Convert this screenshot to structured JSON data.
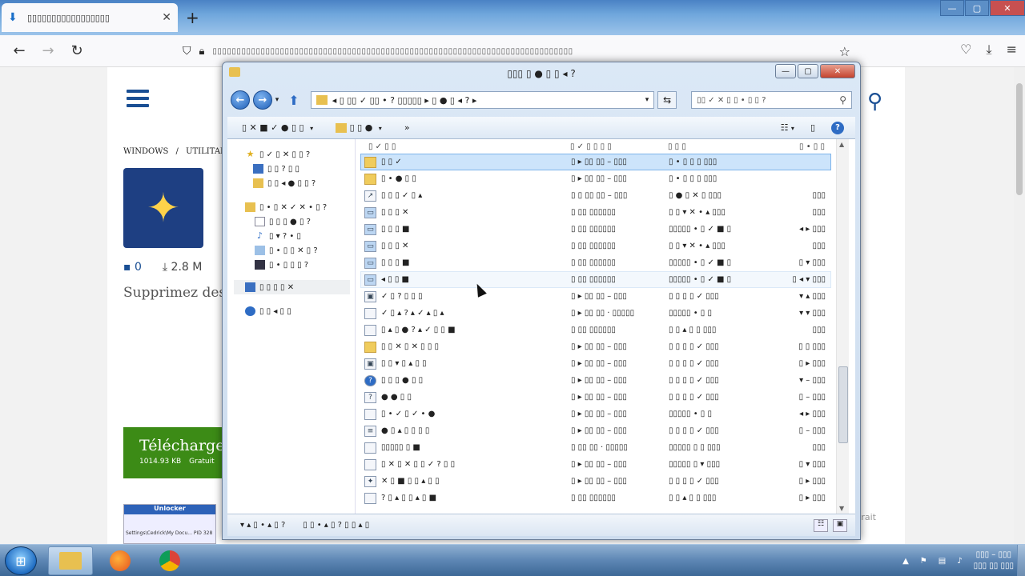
{
  "browser": {
    "tab_title": "▯▯▯▯▯▯▯▯▯▯▯▯▯▯▯▯▯",
    "tab_icon": "download-icon",
    "url": "▯▯▯▯▯▯▯▯▯▯▯▯▯▯▯▯▯▯▯▯▯▯▯▯▯▯▯▯▯▯▯▯▯▯▯▯▯▯▯▯▯▯▯▯▯▯▯▯▯▯▯▯▯▯▯▯▯▯▯▯▯▯▯▯▯▯▯▯▯▯▯▯▯▯▯"
  },
  "page": {
    "breadcrumb_windows": "WINDOWS",
    "breadcrumb_sep": "/",
    "breadcrumb_utilities": "UTILITAIR",
    "comments_count": "0",
    "downloads_count": "2.8 M",
    "description": "Supprimez des",
    "download_label": "Télécharge",
    "download_size": "1014.93 KB",
    "download_price": "Gratuit",
    "thumb_title": "Unlocker",
    "thumb_path": "Settings\\Cedrick\\My Docu...",
    "thumb_pid_label": "PID",
    "thumb_pid": "328",
    "side_word": "trait"
  },
  "explorer": {
    "title": "▯▯▯ ▯ ● ▯ ▯ ◂ ?",
    "address_path": "◂ ▯ ▯▯ ✓ ▯▯ • ? ▯▯▯▯▯ ▸ ▯ ● ▯ ◂ ? ▸",
    "search_placeholder": "▯▯ ✓ ✕ ▯ ▯ • ▯ ▯ ?",
    "toolbar_organize": "▯ ✕ ■ ✓ ● ▯ ▯",
    "toolbar_include": "▯ ▯ ●",
    "toolbar_more": "»",
    "nav": [
      {
        "label": "▯ ✓ ▯ ✕ ▯ ▯ ?",
        "icon": "star-icon"
      },
      {
        "label": "▯ ▯ ? ▯ ▯",
        "icon": "desktop-icon"
      },
      {
        "label": "▯ ▯ ◂ ● ▯ ▯ ?",
        "icon": "downloads-folder-icon"
      },
      {
        "label": "▯ • ▯ ✕ ✓ ✕ • ▯ ?",
        "icon": "libraries-icon"
      },
      {
        "label": "▯ ▯ ▯ ● ▯ ?",
        "icon": "documents-icon"
      },
      {
        "label": "▯ ▾ ? • ▯",
        "icon": "music-icon"
      },
      {
        "label": "▯ • ▯ ▯ ✕ ▯ ?",
        "icon": "pictures-icon"
      },
      {
        "label": "▯ • ▯ ▯ ▯ ?",
        "icon": "videos-icon"
      },
      {
        "label": "▯ ▯ ▯ ▯ ✕",
        "icon": "computer-icon"
      },
      {
        "label": "▯ ▯ ◂ ▯ ▯",
        "icon": "network-icon"
      }
    ],
    "columns": {
      "name": "▯ ✓ ▯ ▯",
      "date": "▯ ✓ ▯ ▯ ▯ ▯",
      "type": "▯ ▯ ▯",
      "size": "▯ • ▯ ▯"
    },
    "rows": [
      {
        "name": "▯ ▯ ✓",
        "date": "▯ ▸ ▯▯ ▯▯ – ▯▯▯",
        "type": "▯ • ▯ ▯ ▯ ▯▯▯",
        "size": "",
        "icon": "folder-icon"
      },
      {
        "name": "▯ • ● ▯ ▯",
        "date": "▯ ▸ ▯▯ ▯▯ – ▯▯▯",
        "type": "▯ • ▯ ▯ ▯ ▯▯▯",
        "size": "",
        "icon": "folder-icon"
      },
      {
        "name": "▯ ▯ ▯ ✓ ▯ ▴",
        "date": "▯ ▯ ▯▯ ▯▯ – ▯▯▯",
        "type": "▯ ● ▯ ✕ ▯ ▯▯▯",
        "size": "▯▯▯",
        "icon": "shortcut-icon"
      },
      {
        "name": "▯ ▯ ▯ ✕",
        "date": "▯ ▯▯ ▯▯▯▯▯▯",
        "type": "▯ ▯ ▾ ✕ • ▴ ▯▯▯",
        "size": "▯▯▯",
        "icon": "image-icon"
      },
      {
        "name": "▯ ▯ ▯ ■",
        "date": "▯ ▯▯ ▯▯▯▯▯▯",
        "type": "▯▯▯▯▯ • ▯ ✓ ■ ▯",
        "size": "◂ ▸ ▯▯▯",
        "icon": "image-icon"
      },
      {
        "name": "▯ ▯ ▯ ✕",
        "date": "▯ ▯▯ ▯▯▯▯▯▯",
        "type": "▯ ▯ ▾ ✕ • ▴ ▯▯▯",
        "size": "▯▯▯",
        "icon": "image-icon"
      },
      {
        "name": "▯ ▯ ▯ ■",
        "date": "▯ ▯▯ ▯▯▯▯▯▯",
        "type": "▯▯▯▯▯ • ▯ ✓ ■ ▯",
        "size": "▯ ▾ ▯▯▯",
        "icon": "image-icon"
      },
      {
        "name": "◂ ▯ ▯ ■",
        "date": "▯ ▯▯ ▯▯▯▯▯▯",
        "type": "▯▯▯▯▯ • ▯ ✓ ■ ▯",
        "size": "▯ ◂ ▾ ▯▯▯",
        "icon": "image-icon"
      },
      {
        "name": "✓ ▯ ? ▯ ▯ ▯",
        "date": "▯ ▸ ▯▯ ▯▯ – ▯▯▯",
        "type": "▯ ▯ ▯ ▯ ✓ ▯▯▯",
        "size": "▾ ▴ ▯▯▯",
        "icon": "exe-icon"
      },
      {
        "name": "✓ ▯ ▴ ? ▴ ✓ ▴ ▯ ▴",
        "date": "▯ ▸ ▯▯ ▯▯ · ▯▯▯▯▯",
        "type": "▯▯▯▯▯ • ▯ ▯",
        "size": "▾ ▾ ▯▯▯",
        "icon": "file-icon"
      },
      {
        "name": "▯ ▴ ▯ ● ? ▴ ✓ ▯ ▯ ■",
        "date": "▯ ▯▯ ▯▯▯▯▯▯",
        "type": "▯ ▯ ▴ ▯ ▯ ▯▯▯",
        "size": "▯▯▯",
        "icon": "file-icon"
      },
      {
        "name": "▯ ▯ ✕ ▯ ✕ ▯ ▯ ▯",
        "date": "▯ ▸ ▯▯ ▯▯ – ▯▯▯",
        "type": "▯ ▯ ▯ ▯ ✓ ▯▯▯",
        "size": "▯ ▯ ▯▯▯",
        "icon": "folder-open-icon"
      },
      {
        "name": "▯ ▯ ▾ ▯ ▴ ▯ ▯",
        "date": "▯ ▸ ▯▯ ▯▯ – ▯▯▯",
        "type": "▯ ▯ ▯ ▯ ✓ ▯▯▯",
        "size": "▯ ▸ ▯▯▯",
        "icon": "exe-icon"
      },
      {
        "name": "▯ ▯ ▯ ● ▯ ▯",
        "date": "▯ ▸ ▯▯ ▯▯ – ▯▯▯",
        "type": "▯ ▯ ▯ ▯ ✓ ▯▯▯",
        "size": "▾ – ▯▯▯",
        "icon": "help-icon"
      },
      {
        "name": "● ● ▯ ▯",
        "date": "▯ ▸ ▯▯ ▯▯ – ▯▯▯",
        "type": "▯ ▯ ▯ ▯ ✓ ▯▯▯",
        "size": "▯ – ▯▯▯",
        "icon": "script-icon"
      },
      {
        "name": "▯ • ✓ ▯ ✓ • ●",
        "date": "▯ ▸ ▯▯ ▯▯ – ▯▯▯",
        "type": "▯▯▯▯▯ • ▯ ▯",
        "size": "◂ ▸ ▯▯▯",
        "icon": "file-icon"
      },
      {
        "name": "● ▯ ▴ ▯ ▯ ▯ ▯",
        "date": "▯ ▸ ▯▯ ▯▯ – ▯▯▯",
        "type": "▯ ▯ ▯ ▯ ✓ ▯▯▯",
        "size": "▯ – ▯▯▯",
        "icon": "notepad-icon"
      },
      {
        "name": "▯▯▯▯▯ ▯ ■",
        "date": "▯ ▯▯ ▯▯ · ▯▯▯▯▯",
        "type": "▯▯▯▯▯ ▯ ▯ ▯▯▯",
        "size": "▯▯▯",
        "icon": "file-icon"
      },
      {
        "name": "▯ ✕ ▯ ✕ ▯ ▯ ✓ ? ▯ ▯",
        "date": "▯ ▸ ▯▯ ▯▯ – ▯▯▯",
        "type": "▯▯▯▯▯ ▯ ▾ ▯▯▯",
        "size": "▯ ▾ ▯▯▯",
        "icon": "file-icon"
      },
      {
        "name": "✕ ▯ ■ ▯ ▯ ▴ ▯ ▯",
        "date": "▯ ▸ ▯▯ ▯▯ – ▯▯▯",
        "type": "▯ ▯ ▯ ▯ ✓ ▯▯▯",
        "size": "▯ ▸ ▯▯▯",
        "icon": "setup-icon"
      },
      {
        "name": "? ▯ ▴ ▯ ▯ ▴ ▯ ■",
        "date": "▯ ▯▯ ▯▯▯▯▯▯",
        "type": "▯ ▯ ▴ ▯ ▯ ▯▯▯",
        "size": "▯ ▸ ▯▯▯",
        "icon": "file-icon"
      }
    ],
    "status_count": "▾ ▴ ▯ • ▴ ▯ ?",
    "status_selected": "▯ ▯ • ▴ ▯ ? ▯ ▯ ▴ ▯"
  },
  "taskbar": {
    "clock_time": "▯▯▯ – ▯▯▯",
    "clock_date": "▯▯▯ ▯▯ ▯▯▯"
  },
  "colors": {
    "selection": "#cce4fb",
    "accent_blue": "#1a4f94",
    "download_green": "#3c8b16"
  }
}
